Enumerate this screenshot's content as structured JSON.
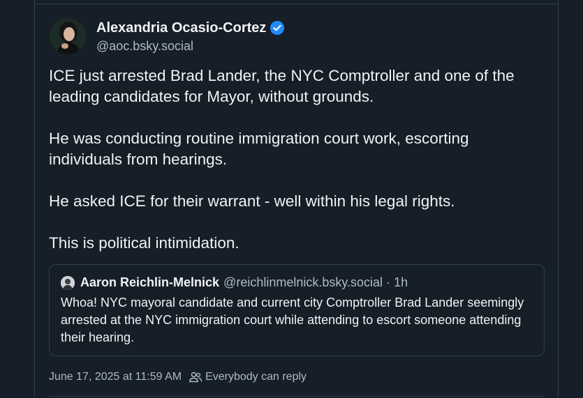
{
  "post": {
    "author": {
      "display_name": "Alexandria Ocasio-Cortez",
      "handle": "@aoc.bsky.social",
      "verified_icon": "verified-check-icon",
      "avatar_icon": "avatar"
    },
    "paragraphs": [
      "ICE just arrested Brad Lander, the NYC Comptroller and one of the leading candidates for Mayor, without grounds.",
      "He was conducting routine immigration court work, escorting individuals from hearings.",
      "He asked ICE for their warrant - well within his legal rights.",
      "This is political intimidation."
    ],
    "quote": {
      "author_name": "Aaron Reichlin-Melnick",
      "handle": "@reichlinmelnick.bsky.social",
      "separator": "·",
      "time": "1h",
      "text": "Whoa! NYC mayoral candidate and current city Comptroller Brad Lander seemingly arrested at the NYC immigration court while attending to escort someone attending their hearing."
    },
    "timestamp": "June 17, 2025 at 11:59 AM",
    "reply_setting": "Everybody can reply",
    "reply_icon": "people-icon"
  },
  "colors": {
    "background": "#161e27",
    "border": "#2e4052",
    "text_primary": "#f1f3f5",
    "text_secondary": "#aebbc9",
    "verified_blue": "#208bfe"
  }
}
